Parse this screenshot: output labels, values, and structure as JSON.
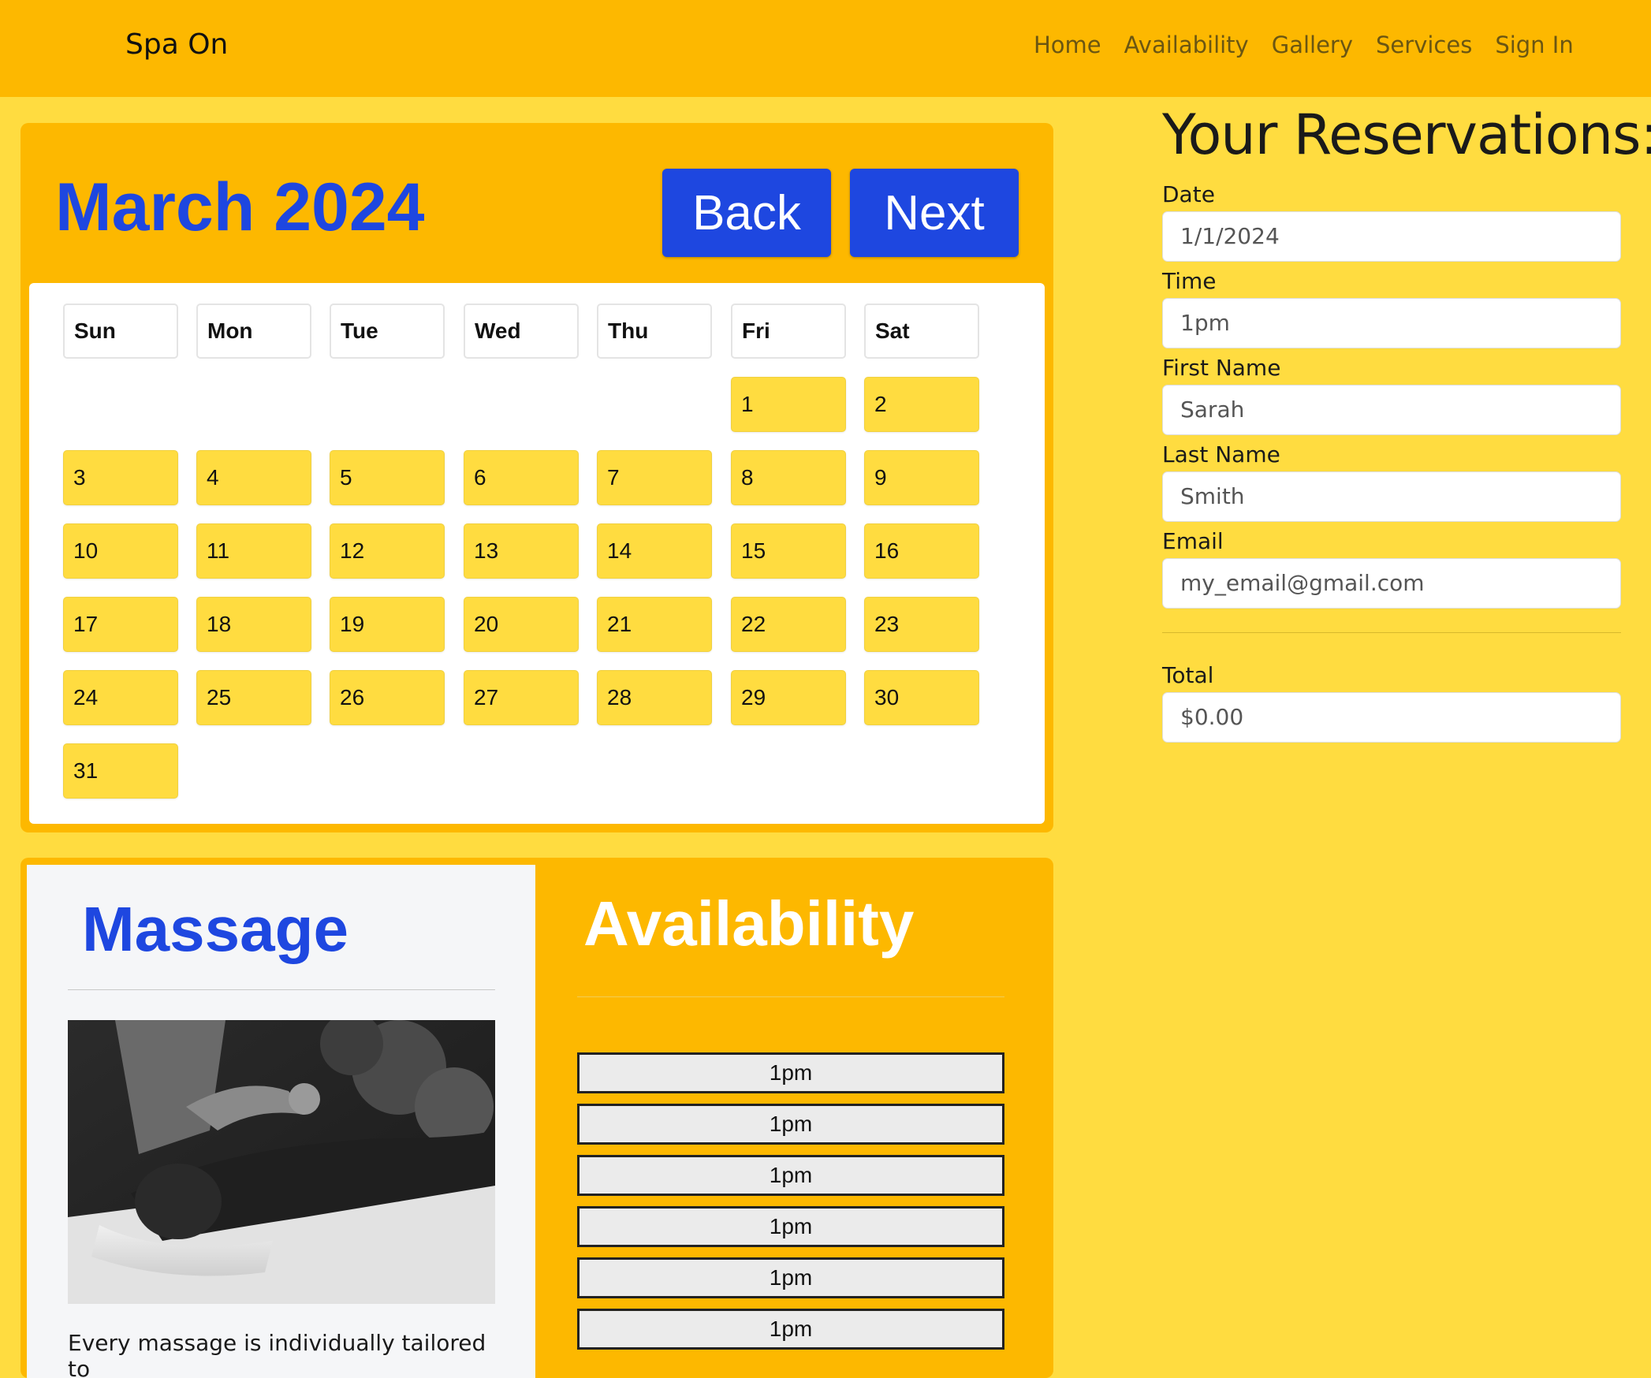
{
  "nav": {
    "brand": "Spa On",
    "links": [
      "Home",
      "Availability",
      "Gallery",
      "Services",
      "Sign In"
    ]
  },
  "calendar": {
    "title": "March 2024",
    "back_label": "Back",
    "next_label": "Next",
    "weekdays": [
      "Sun",
      "Mon",
      "Tue",
      "Wed",
      "Thu",
      "Fri",
      "Sat"
    ],
    "first_weekday_index": 5,
    "days": [
      "1",
      "2",
      "3",
      "4",
      "5",
      "6",
      "7",
      "8",
      "9",
      "10",
      "11",
      "12",
      "13",
      "14",
      "15",
      "16",
      "17",
      "18",
      "19",
      "20",
      "21",
      "22",
      "23",
      "24",
      "25",
      "26",
      "27",
      "28",
      "29",
      "30",
      "31"
    ]
  },
  "reservation": {
    "title": "Your Reservations:",
    "date_label": "Date",
    "date_value": "1/1/2024",
    "time_label": "Time",
    "time_value": "1pm",
    "first_name_label": "First Name",
    "first_name_value": "Sarah",
    "last_name_label": "Last Name",
    "last_name_value": "Smith",
    "email_label": "Email",
    "email_value": "my_email@gmail.com",
    "total_label": "Total",
    "total_value": "$0.00"
  },
  "service": {
    "title": "Massage",
    "description": "Every massage is individually tailored to",
    "image_icon": "massage-photo"
  },
  "availability": {
    "title": "Availability",
    "slots": [
      "1pm",
      "1pm",
      "1pm",
      "1pm",
      "1pm",
      "1pm"
    ]
  },
  "colors": {
    "page_bg": "#FFDC40",
    "panel_bg": "#FDB800",
    "accent_blue": "#1E47E0"
  }
}
